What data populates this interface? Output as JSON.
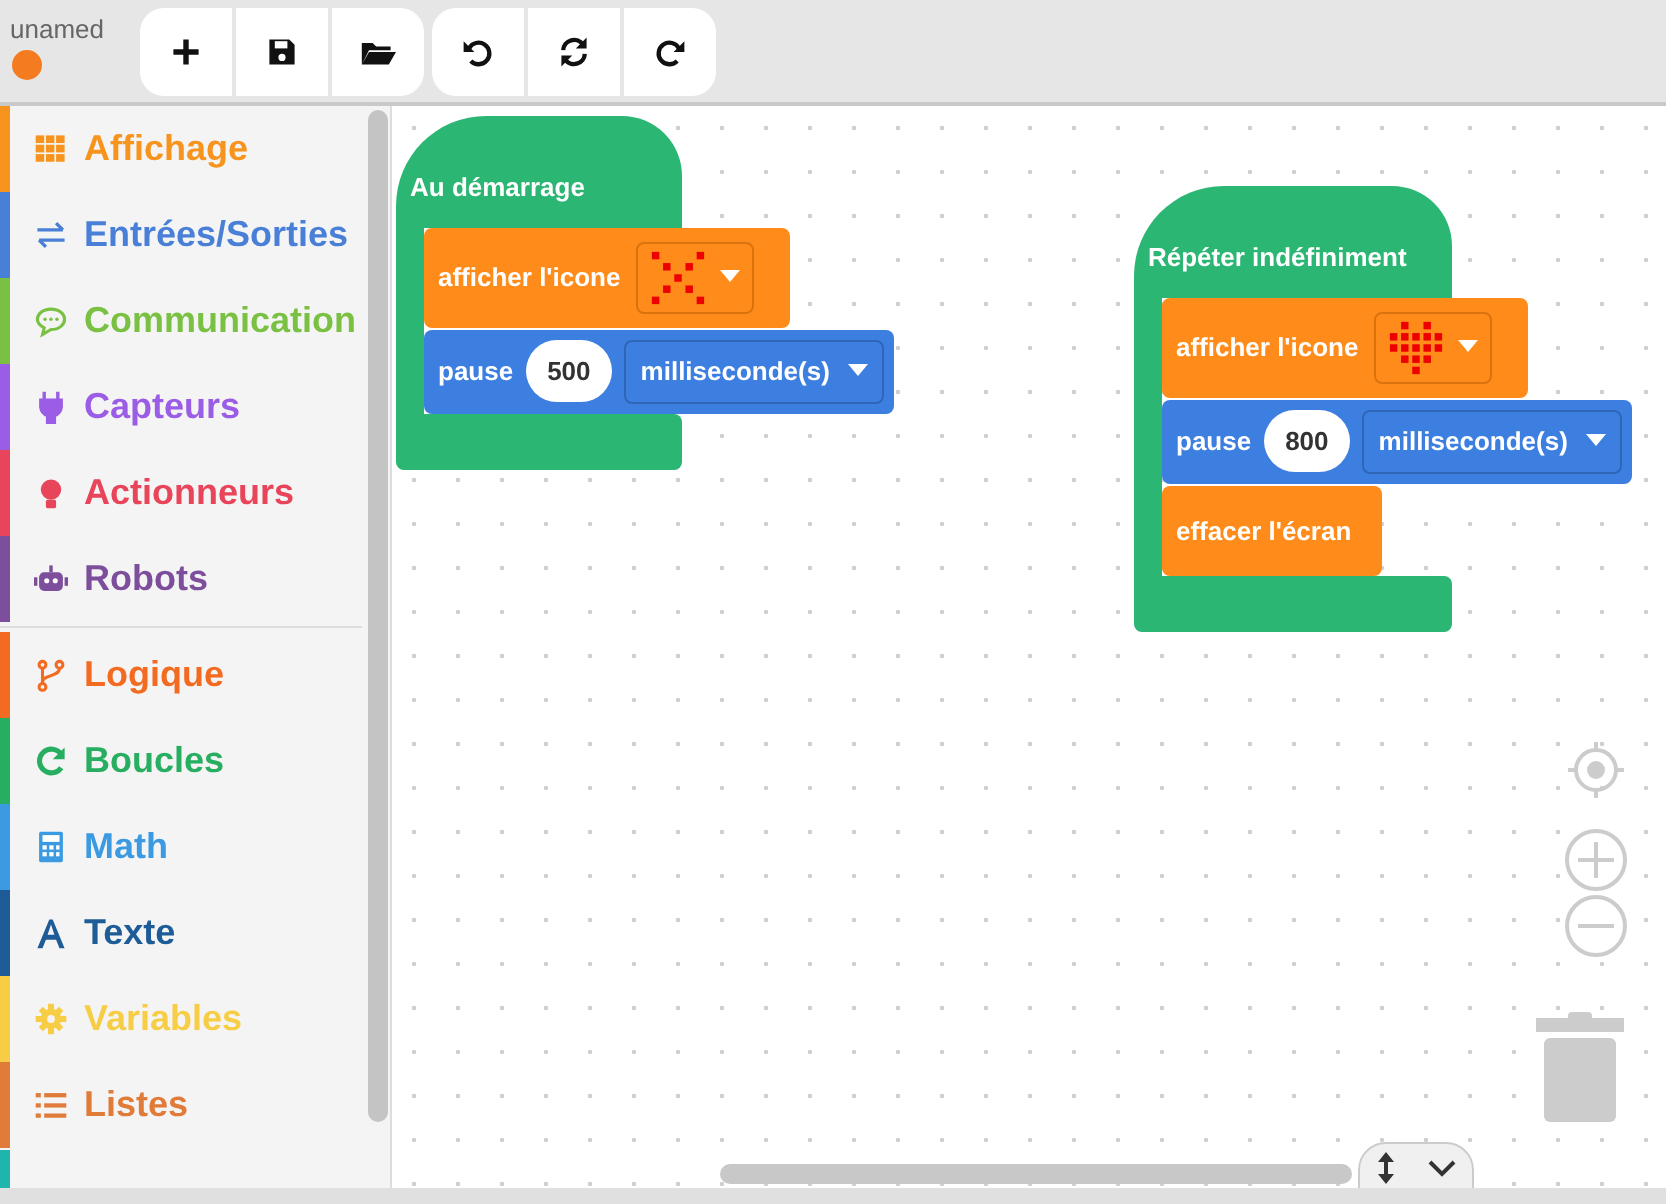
{
  "project": {
    "name": "unamed"
  },
  "categories": [
    {
      "label": "Affichage",
      "color": "#f7941d"
    },
    {
      "label": "Entrées/Sorties",
      "color": "#4a7fd8"
    },
    {
      "label": "Communication",
      "color": "#7ac143"
    },
    {
      "label": "Capteurs",
      "color": "#9b5de5"
    },
    {
      "label": "Actionneurs",
      "color": "#e8445a"
    },
    {
      "label": "Robots",
      "color": "#7d4e9b"
    },
    {
      "label": "Logique",
      "color": "#f26b21"
    },
    {
      "label": "Boucles",
      "color": "#27ae60"
    },
    {
      "label": "Math",
      "color": "#3b9ae1"
    },
    {
      "label": "Texte",
      "color": "#1d5c96"
    },
    {
      "label": "Variables",
      "color": "#f7cd46"
    },
    {
      "label": "Listes",
      "color": "#e07b39"
    }
  ],
  "cut_off_category": {
    "color": "#1fb5ad"
  },
  "scripts": [
    {
      "hat": "Au démarrage",
      "blocks": [
        {
          "kind": "show_icon",
          "label": "afficher l'icone"
        },
        {
          "kind": "pause",
          "label": "pause",
          "value": "500",
          "unit": "milliseconde(s)"
        }
      ]
    },
    {
      "hat": "Répéter indéfiniment",
      "blocks": [
        {
          "kind": "show_icon",
          "label": "afficher l'icone"
        },
        {
          "kind": "pause",
          "label": "pause",
          "value": "800",
          "unit": "milliseconde(s)"
        },
        {
          "kind": "clear",
          "label": "effacer l'écran"
        }
      ]
    }
  ]
}
